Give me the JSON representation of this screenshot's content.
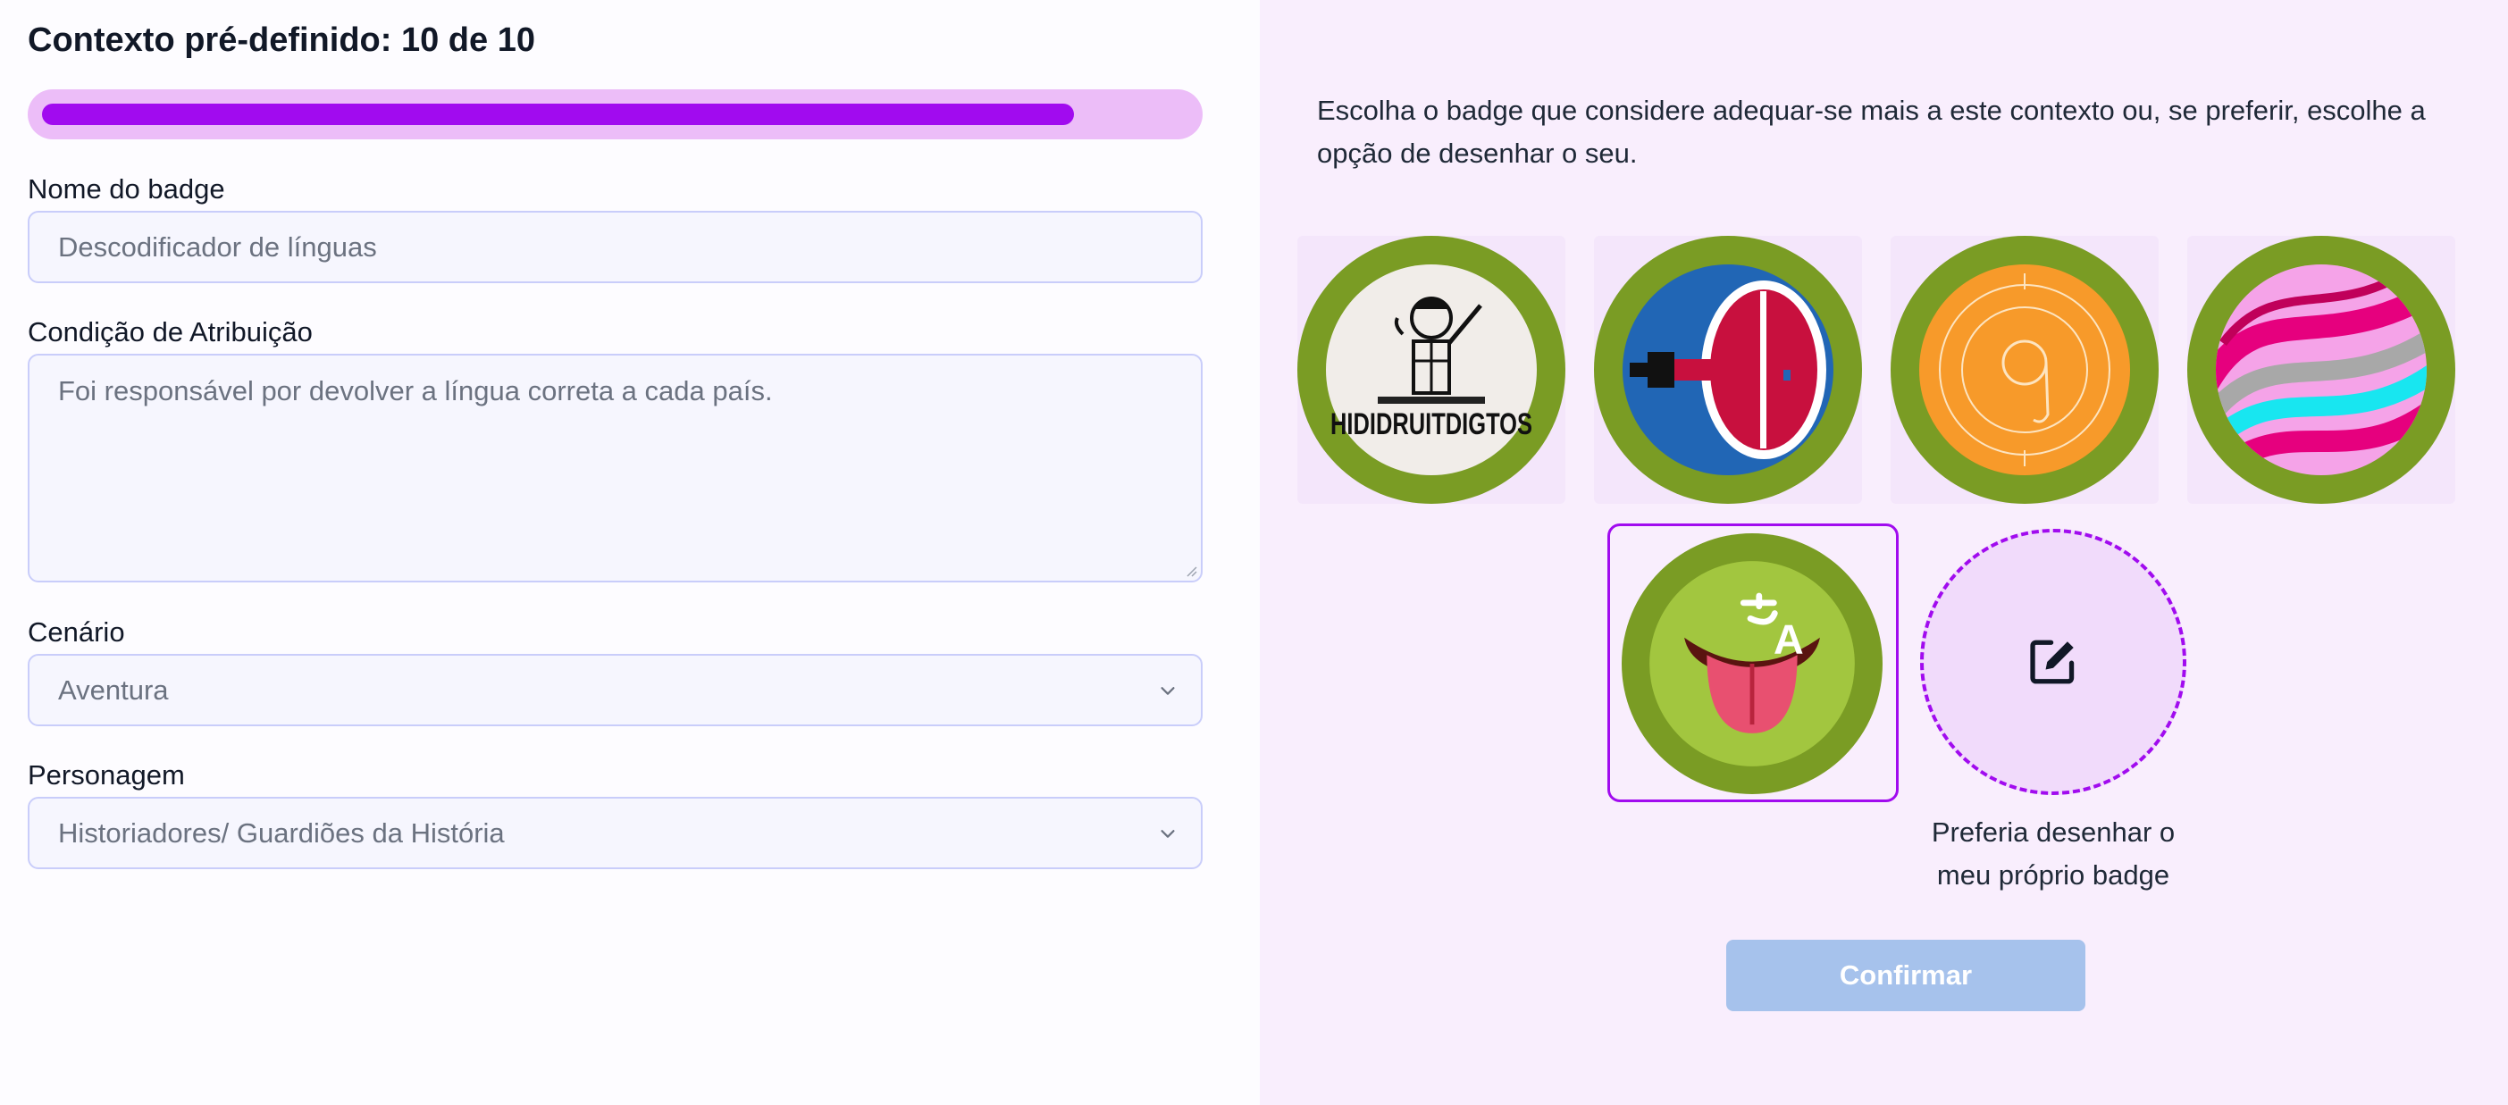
{
  "form": {
    "title": "Contexto pré-definido: 10 de 10",
    "progress": 0.9,
    "badge_name_label": "Nome do badge",
    "badge_name_value": "Descodificador de línguas",
    "condition_label": "Condição de Atribuição",
    "condition_value": "Foi responsável por devolver a língua correta a cada país.",
    "scenario_label": "Cenário",
    "scenario_value": "Aventura",
    "character_label": "Personagem",
    "character_value": "Historiadores/ Guardiões da História"
  },
  "picker": {
    "instruction": "Escolha o badge que considere adequar-se mais a este contexto ou, se preferir, escolhe a opção de desenhar o seu.",
    "badge_1_text": "HIDIDRUITDIGTOS",
    "draw_caption_line1": "Preferia desenhar o",
    "draw_caption_line2": "meu próprio badge",
    "confirm_label": "Confirmar"
  },
  "colors": {
    "accent": "#a10bef",
    "badge_ring": "#7a9c24",
    "confirm_disabled": "#a6c2ec"
  },
  "icons": {
    "selected_badge": "translate-tongue-icon",
    "draw": "edit-square-icon",
    "select_chevron": "chevron-down-icon"
  }
}
